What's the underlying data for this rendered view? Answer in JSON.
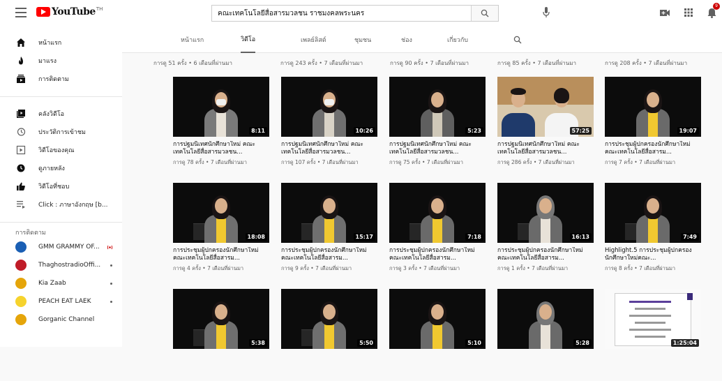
{
  "header": {
    "logo_text": "YouTube",
    "logo_sup": "TH",
    "search_value": "คณะเทคโนโลยีสื่อสารมวลชน ราชมงคลพระนคร",
    "notification_count": "9"
  },
  "sidebar": {
    "primary": [
      {
        "label": "หน้าแรก",
        "icon": "home-icon"
      },
      {
        "label": "มาแรง",
        "icon": "trending-icon"
      },
      {
        "label": "การติดตาม",
        "icon": "subscriptions-icon"
      }
    ],
    "library": [
      {
        "label": "คลังวิดีโอ",
        "icon": "library-icon"
      },
      {
        "label": "ประวัติการเข้าชม",
        "icon": "history-icon"
      },
      {
        "label": "วิดีโอของคุณ",
        "icon": "your-videos-icon"
      },
      {
        "label": "ดูภายหลัง",
        "icon": "watch-later-icon"
      },
      {
        "label": "วิดีโอที่ชอบ",
        "icon": "liked-icon"
      },
      {
        "label": "Click : ภาษาอังกฤษ [b...",
        "icon": "playlist-icon"
      }
    ],
    "subscriptions_heading": "การติดตาม",
    "subscriptions": [
      {
        "name": "GMM GRAMMY OF...",
        "color": "#1a5fb4",
        "live": true
      },
      {
        "name": "ThaghostradioOffi...",
        "color": "#c01c28",
        "live": false
      },
      {
        "name": "Kia Zaab",
        "color": "#e5a50a",
        "live": false
      },
      {
        "name": "PEACH EAT LAEK",
        "color": "#f6d32d",
        "live": false
      },
      {
        "name": "Gorganic Channel",
        "color": "#e5a50a",
        "live": false
      }
    ]
  },
  "tabs": [
    "หน้าแรก",
    "วิดีโอ",
    "เพลย์ลิสต์",
    "ชุมชน",
    "ช่อง",
    "เกี่ยวกับ"
  ],
  "active_tab": "วิดีโอ",
  "top_meta": [
    "การดู 51 ครั้ง • 6 เดือนที่ผ่านมา",
    "การดู 243 ครั้ง • 7 เดือนที่ผ่านมา",
    "การดู 90 ครั้ง • 7 เดือนที่ผ่านมา",
    "การดู 85 ครั้ง • 7 เดือนที่ผ่านมา",
    "การดู 208 ครั้ง • 7 เดือนที่ผ่านมา"
  ],
  "rows": [
    [
      {
        "duration": "8:11",
        "title": "การปฐมนิเทศนักศึกษาใหม่ คณะเทคโนโลยีสื่อสารมวลชน...",
        "meta": "การดู 78 ครั้ง • 7 เดือนที่ผ่านมา"
      },
      {
        "duration": "10:26",
        "title": "การปฐมนิเทศนักศึกษาใหม่ คณะเทคโนโลยีสื่อสารมวลชน...",
        "meta": "การดู 107 ครั้ง • 7 เดือนที่ผ่านมา"
      },
      {
        "duration": "5:23",
        "title": "การปฐมนิเทศนักศึกษาใหม่ คณะเทคโนโลยีสื่อสารมวลชน...",
        "meta": "การดู 75 ครั้ง • 7 เดือนที่ผ่านมา"
      },
      {
        "duration": "57:25",
        "title": "การปฐมนิเทศนักศึกษาใหม่ คณะเทคโนโลยีสื่อสารมวลชน...",
        "meta": "การดู 286 ครั้ง • 7 เดือนที่ผ่านมา"
      },
      {
        "duration": "19:07",
        "title": "การประชุมผู้ปกครองนักศึกษาใหม่คณะเทคโนโลยีสื่อสารม...",
        "meta": "การดู 7 ครั้ง • 7 เดือนที่ผ่านมา"
      }
    ],
    [
      {
        "duration": "18:08",
        "title": "การประชุมผู้ปกครองนักศึกษาใหม่คณะเทคโนโลยีสื่อสารม...",
        "meta": "การดู 4 ครั้ง • 7 เดือนที่ผ่านมา"
      },
      {
        "duration": "15:17",
        "title": "การประชุมผู้ปกครองนักศึกษาใหม่คณะเทคโนโลยีสื่อสารม...",
        "meta": "การดู 9 ครั้ง • 7 เดือนที่ผ่านมา"
      },
      {
        "duration": "7:18",
        "title": "การประชุมผู้ปกครองนักศึกษาใหม่คณะเทคโนโลยีสื่อสารม...",
        "meta": "การดู 3 ครั้ง • 7 เดือนที่ผ่านมา"
      },
      {
        "duration": "16:13",
        "title": "การประชุมผู้ปกครองนักศึกษาใหม่คณะเทคโนโลยีสื่อสารม...",
        "meta": "การดู 1 ครั้ง • 7 เดือนที่ผ่านมา"
      },
      {
        "duration": "7:49",
        "title": "Highlight.5 การประชุมผู้ปกครองนักศึกษาใหม่คณะ...",
        "meta": "การดู 8 ครั้ง • 7 เดือนที่ผ่านมา"
      }
    ],
    [
      {
        "duration": "5:38",
        "title": "",
        "meta": ""
      },
      {
        "duration": "5:50",
        "title": "",
        "meta": ""
      },
      {
        "duration": "5:10",
        "title": "",
        "meta": ""
      },
      {
        "duration": "5:28",
        "title": "",
        "meta": ""
      },
      {
        "duration": "1:25:04",
        "title": "",
        "meta": ""
      }
    ]
  ]
}
